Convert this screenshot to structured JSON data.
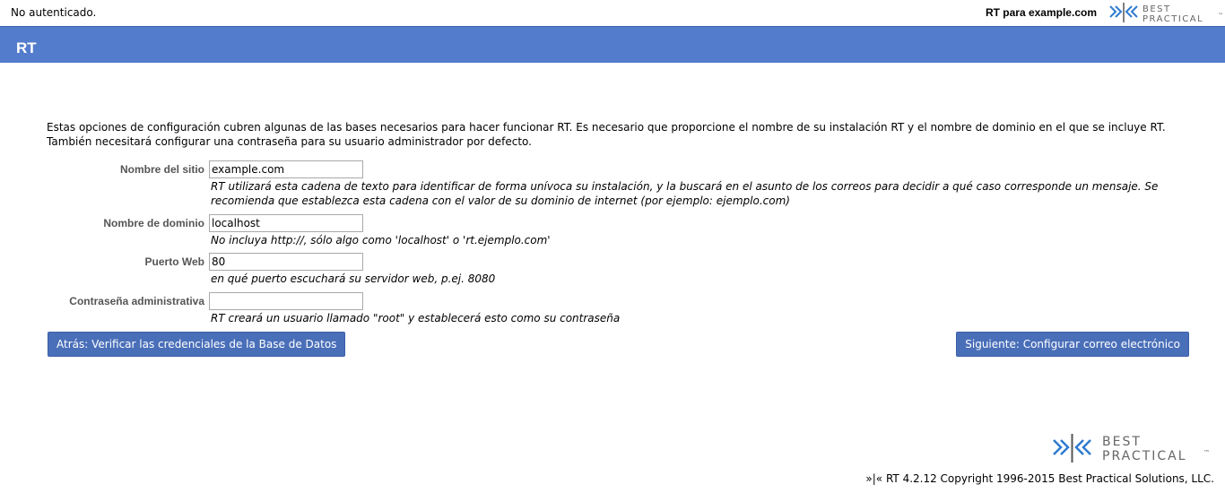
{
  "topbar": {
    "status": "No autenticado.",
    "site_label": "RT para example.com",
    "logo_text_line1": "BEST",
    "logo_text_line2": "PRACTICAL",
    "logo_tm": "™"
  },
  "header": {
    "title": "RT"
  },
  "intro": {
    "text": "Estas opciones de configuración cubren algunas de las bases necesarios para hacer funcionar RT. Es necesario que proporcione el nombre de su instalación RT y el nombre de dominio en el que se incluye RT. También necesitará configurar una contraseña para su usuario administrador por defecto."
  },
  "form": {
    "site_name": {
      "label": "Nombre del sitio",
      "value": "example.com",
      "hint": "RT utilizará esta cadena de texto para identificar de forma unívoca su instalación, y la buscará en el asunto de los correos para decidir a qué caso corresponde un mensaje. Se recomienda que establezca esta cadena con el valor de su dominio de internet (por ejemplo: ejemplo.com)"
    },
    "domain": {
      "label": "Nombre de dominio",
      "value": "localhost",
      "hint": "No incluya http://, sólo algo como 'localhost' o 'rt.ejemplo.com'"
    },
    "web_port": {
      "label": "Puerto Web",
      "value": "80",
      "hint": "en qué puerto escuchará su servidor web, p.ej. 8080"
    },
    "admin_password": {
      "label": "Contraseña administrativa",
      "value": "",
      "hint": "RT creará un usuario llamado \"root\" y establecerá esto como su contraseña"
    }
  },
  "buttons": {
    "back": "Atrás: Verificar las credenciales de la Base de Datos",
    "next": "Siguiente: Configurar correo electrónico"
  },
  "footer": {
    "text": "»|« RT 4.2.12 Copyright 1996-2015 Best Practical Solutions, LLC."
  },
  "colors": {
    "header_bg": "#547CCC",
    "button_bg": "#4a6fb9",
    "logo_blue": "#2d7bd0"
  }
}
